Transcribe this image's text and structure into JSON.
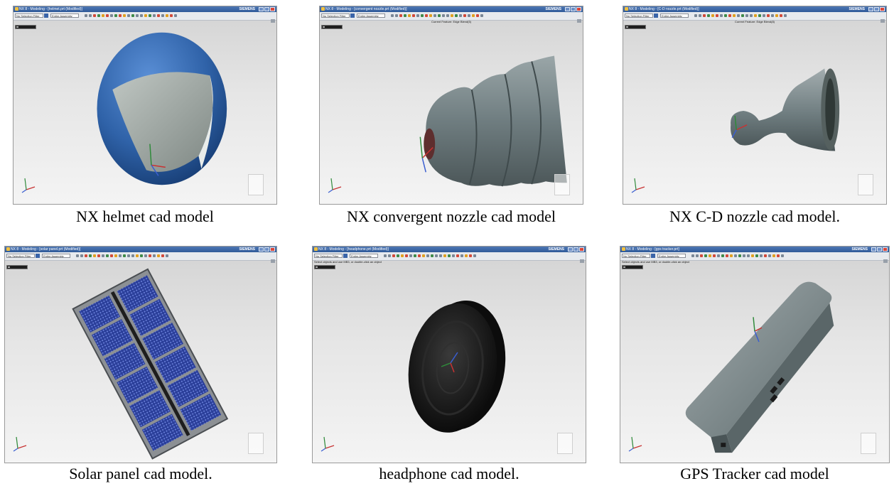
{
  "panels": [
    {
      "caption": "NX helmet cad model",
      "window_title": "NX 8 - Modeling - [helmet.prt (Modified)]",
      "brand": "SIEMENS",
      "selection_filter": "No Selection Filter",
      "assembly_scope": "Entire Assembly",
      "cue_text": ""
    },
    {
      "caption": "NX convergent nozzle cad model",
      "window_title": "NX 8 - Modeling - [convergent nozzle.prt (Modified)]",
      "brand": "SIEMENS",
      "selection_filter": "No Selection Filter",
      "assembly_scope": "Entire Assembly",
      "cue_text": "Current Feature: Edge Blend(5)"
    },
    {
      "caption": "NX C-D nozzle cad model.",
      "window_title": "NX 8 - Modeling - [C-D nozzle.prt (Modified)]",
      "brand": "SIEMENS",
      "selection_filter": "No Selection Filter",
      "assembly_scope": "Entire Assembly",
      "cue_text": "Current Feature: Edge Blend(8)"
    },
    {
      "caption": "Solar panel cad model.",
      "window_title": "NX 8 - Modeling - [solar panel.prt (Modified)]",
      "brand": "SIEMENS",
      "selection_filter": "No Selection Filter",
      "assembly_scope": "Entire Assembly",
      "cue_text": ""
    },
    {
      "caption": "headphone cad model.",
      "window_title": "NX 8 - Modeling - [headphone.prt (Modified)]",
      "brand": "SIEMENS",
      "selection_filter": "No Selection Filter",
      "assembly_scope": "Entire Assembly",
      "cue_text": "Select objects and use MB3, or double-click an object"
    },
    {
      "caption": "GPS Tracker cad model",
      "window_title": "NX 8 - Modeling - [gps tracker.prt]",
      "brand": "SIEMENS",
      "selection_filter": "No Selection Filter",
      "assembly_scope": "Entire Assembly",
      "cue_text": "Select objects and use MB3, or double-click an object"
    }
  ],
  "colors": {
    "helmet_shell": "#2f62a8",
    "visor": "#9fa7a3",
    "nozzle": "#6f7d80",
    "panel_frame": "#8c9094",
    "solar_cell": "#2b3f9a",
    "headphone": "#141414",
    "tracker": "#7a8a8c",
    "titlebar": "#3a64a8"
  },
  "icons": [
    "app-icon",
    "minimize-icon",
    "maximize-icon",
    "close-icon",
    "axis-triad-icon",
    "dropdown-arrow-icon"
  ]
}
